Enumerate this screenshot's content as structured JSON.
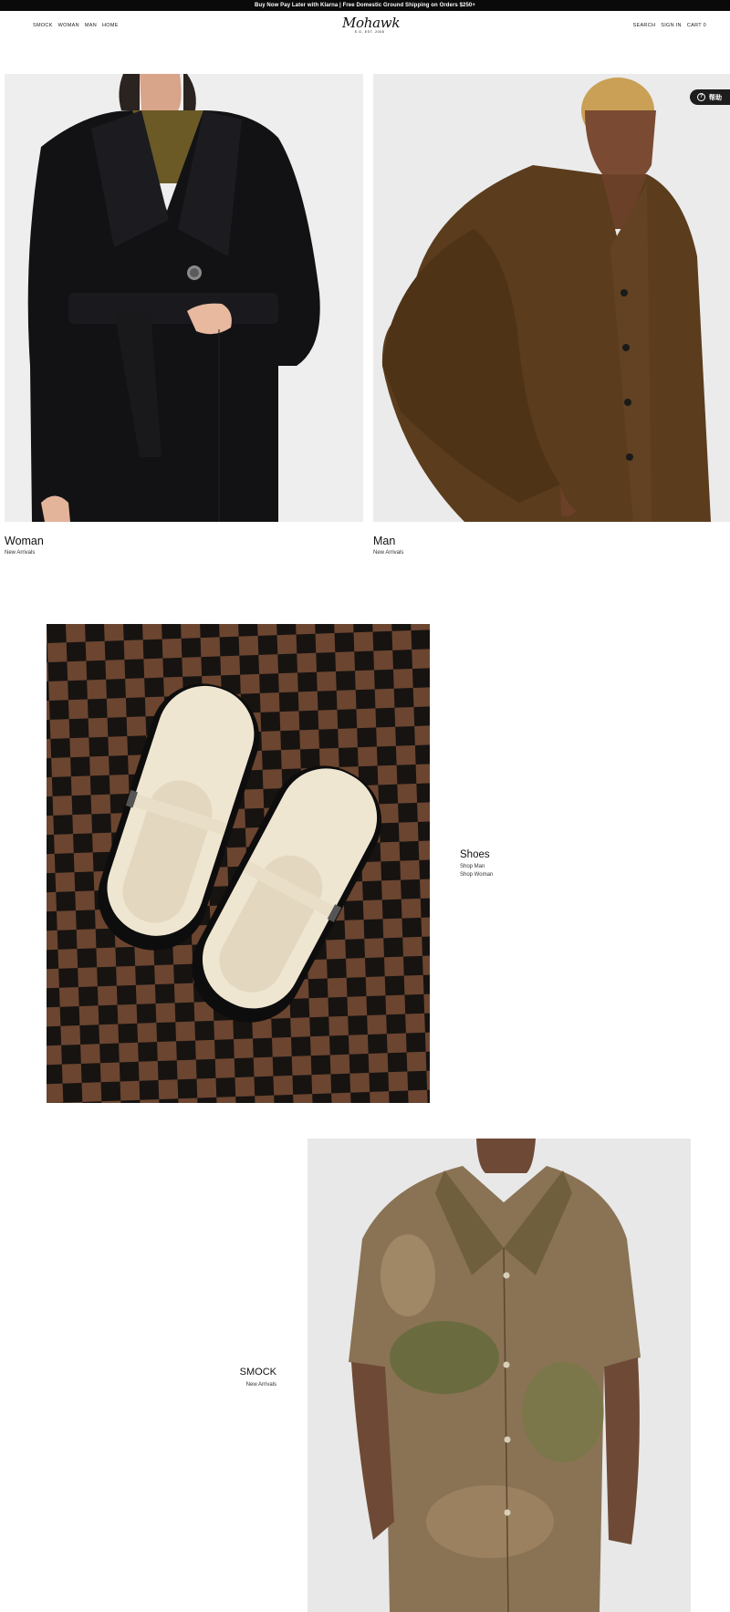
{
  "announcement": "Buy Now Pay Later with Klarna | Free Domestic Ground Shipping on Orders $250+",
  "header": {
    "nav_left": [
      "SMOCK",
      "WOMAN",
      "MAN",
      "HOME"
    ],
    "logo_text": "Mohawk",
    "logo_tagline": "E.G. EST. 2008",
    "nav_right": [
      "SEARCH",
      "SIGN IN",
      "CART 0"
    ]
  },
  "chat": {
    "label": "帮助",
    "icon": "help-circle-icon"
  },
  "sections": {
    "woman": {
      "title": "Woman",
      "subtitle": "New Arrivals",
      "image_alt": "model in black belted wool coat"
    },
    "man": {
      "title": "Man",
      "subtitle": "New Arrivals",
      "image_alt": "model in brown mohair cardigan"
    },
    "shoes": {
      "title": "Shoes",
      "links": [
        "Shop Man",
        "Shop Woman"
      ],
      "image_alt": "cream woven sandals on checkered rug"
    },
    "smock": {
      "title": "SMOCK",
      "subtitle": "New Arrivals",
      "image_alt": "model in tie-dye camp collar shirt"
    }
  },
  "colors": {
    "announcement_bg": "#0a0a0a",
    "chat_bg": "#1d1d1d",
    "checker_brown": "#6b4530",
    "checker_black": "#171311"
  }
}
